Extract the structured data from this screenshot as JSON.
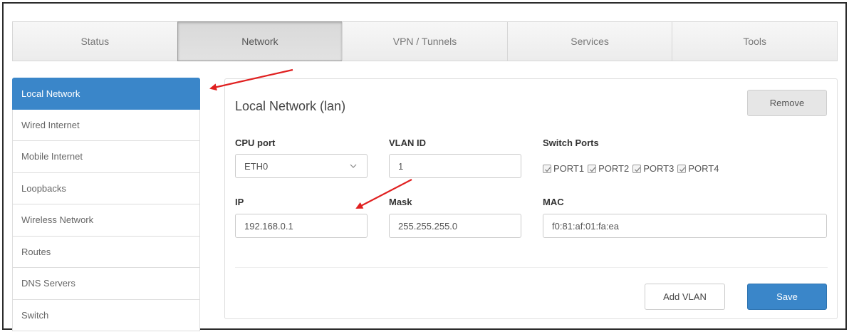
{
  "tabs": [
    {
      "label": "Status"
    },
    {
      "label": "Network"
    },
    {
      "label": "VPN / Tunnels"
    },
    {
      "label": "Services"
    },
    {
      "label": "Tools"
    }
  ],
  "active_tab": "Network",
  "sidebar": {
    "items": [
      {
        "label": "Local Network"
      },
      {
        "label": "Wired Internet"
      },
      {
        "label": "Mobile Internet"
      },
      {
        "label": "Loopbacks"
      },
      {
        "label": "Wireless Network"
      },
      {
        "label": "Routes"
      },
      {
        "label": "DNS Servers"
      },
      {
        "label": "Switch"
      }
    ],
    "active": "Local Network"
  },
  "panel": {
    "title": "Local Network (lan)",
    "remove_label": "Remove",
    "cpu_port": {
      "label": "CPU port",
      "value": "ETH0"
    },
    "vlan_id": {
      "label": "VLAN ID",
      "value": "1"
    },
    "switch_ports": {
      "label": "Switch Ports",
      "ports": [
        {
          "label": "PORT1",
          "checked": true
        },
        {
          "label": "PORT2",
          "checked": true
        },
        {
          "label": "PORT3",
          "checked": true
        },
        {
          "label": "PORT4",
          "checked": true
        }
      ]
    },
    "ip": {
      "label": "IP",
      "value": "192.168.0.1"
    },
    "mask": {
      "label": "Mask",
      "value": "255.255.255.0"
    },
    "mac": {
      "label": "MAC",
      "value": "f0:81:af:01:fa:ea"
    },
    "add_vlan_label": "Add VLAN",
    "save_label": "Save"
  },
  "colors": {
    "accent": "#3a86c9",
    "annotation_arrow": "#e02020"
  }
}
